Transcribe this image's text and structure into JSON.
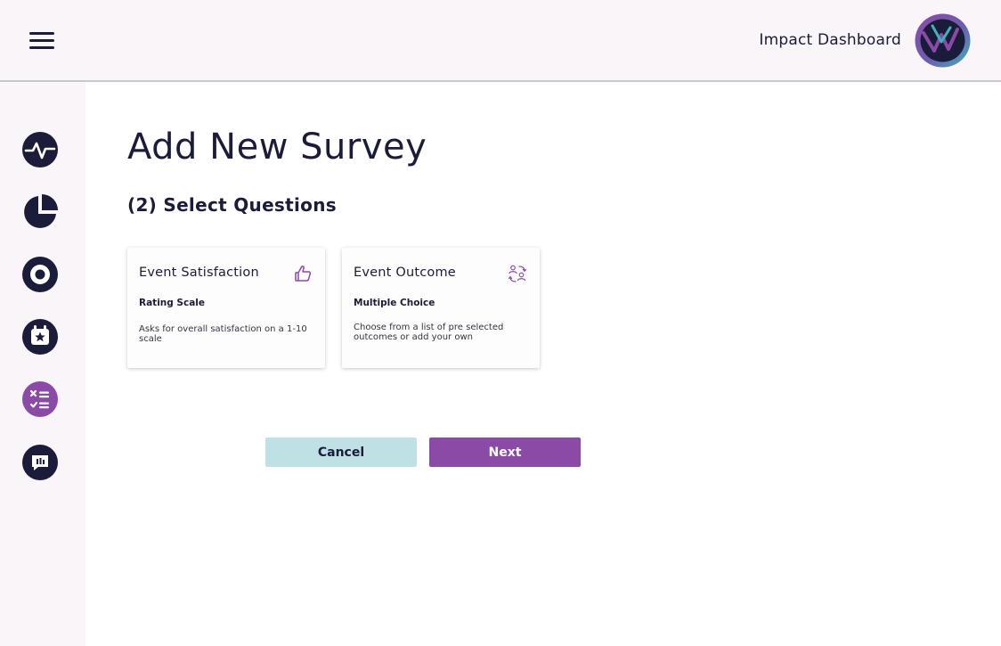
{
  "header": {
    "title": "Impact Dashboard",
    "menu_icon": "hamburger-menu-icon",
    "logo_icon": "impact-logo-icon"
  },
  "sidebar": {
    "items": [
      {
        "icon": "activity-pulse-icon",
        "active": false
      },
      {
        "icon": "pie-chart-icon",
        "active": false
      },
      {
        "icon": "target-icon",
        "active": false
      },
      {
        "icon": "calendar-star-icon",
        "active": false
      },
      {
        "icon": "checklist-icon",
        "active": true
      },
      {
        "icon": "chat-bubble-icon",
        "active": false
      }
    ]
  },
  "main": {
    "title": "Add New Survey",
    "step": "(2) Select Questions",
    "cards": [
      {
        "title": "Event Satisfaction",
        "type": "Rating Scale",
        "description": "Asks for overall satisfaction on a 1-10 scale",
        "icon": "thumbs-up-icon"
      },
      {
        "title": "Event Outcome",
        "type": "Multiple Choice",
        "description": "Choose from a list of pre selected outcomes or add your own",
        "icon": "people-exchange-icon"
      }
    ],
    "buttons": {
      "cancel": "Cancel",
      "next": "Next"
    }
  },
  "colors": {
    "navy": "#1b1b3a",
    "purple": "#8b4aa6",
    "teal": "#3fb3b8",
    "light_teal": "#bfe1e6",
    "header_bg": "#faf5f9",
    "sidebar_bg": "#faf5f9"
  }
}
